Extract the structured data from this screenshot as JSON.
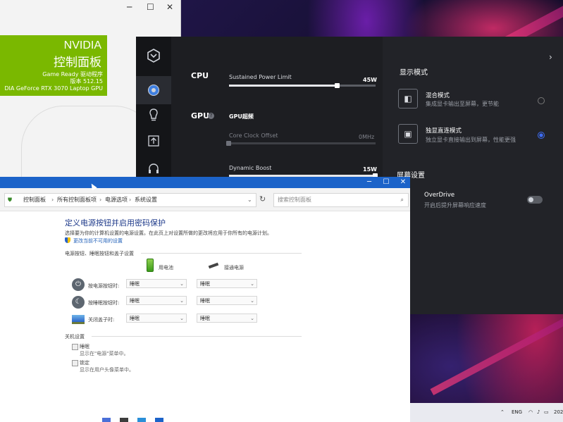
{
  "nvidia": {
    "brand": "NVIDIA",
    "title": "控制面板",
    "driver_line": "Game Ready 驱动程序",
    "version_line": "版本 512.15",
    "gpu_line": "DIA GeForce RTX 3070 Laptop GPU"
  },
  "gaming_center": {
    "cpu_label": "CPU",
    "cpu_spl_label": "Sustained Power Limit",
    "cpu_spl_value": "45W",
    "cpu_spl_level": 0.74,
    "gpu_label": "GPU",
    "gpu_oc_label": "GPU超频",
    "core_clock_label": "Core Clock Offset",
    "core_clock_value": "0MHz",
    "core_clock_level": 0.0,
    "dynamic_boost_label": "Dynamic Boost",
    "dynamic_boost_value": "15W",
    "dynamic_boost_level": 1.0,
    "display_mode_title": "显示模式",
    "mode_hybrid_title": "混合模式",
    "mode_hybrid_desc": "集成显卡输出至屏幕，更节能",
    "mode_discrete_title": "独显直连模式",
    "mode_discrete_desc": "独立显卡直接输出到屏幕，性能更强",
    "screen_settings_title": "屏幕设置",
    "overdrive_title": "OverDrive",
    "overdrive_desc": "开启后提升屏幕响应速度",
    "chevron": "›"
  },
  "control_panel": {
    "breadcrumb": [
      "控制面板",
      "所有控制面板项",
      "电源选项",
      "系统设置"
    ],
    "search_placeholder": "搜索控制面板",
    "heading": "定义电源按钮并启用密码保护",
    "description": "选择要为你的计算机设置的电源设置。在此页上对设置所做的更改将应用于你所有的电源计划。",
    "change_link": "更改当前不可用的设置",
    "section_buttons": "电源按钮、睡眠按钮和盖子设置",
    "col_battery": "用电池",
    "col_plugged": "接通电源",
    "rows": [
      {
        "label": "按电源按钮时:",
        "battery": "睡眠",
        "plugged": "睡眠"
      },
      {
        "label": "按睡眠按钮时:",
        "battery": "睡眠",
        "plugged": "睡眠"
      },
      {
        "label": "关闭盖子时:",
        "battery": "睡眠",
        "plugged": "睡眠"
      }
    ],
    "section_shutdown": "关机设置",
    "sleep_label": "睡眠",
    "sleep_desc": "显示在\"电源\"菜单中。",
    "lock_label": "锁定",
    "lock_desc": "显示在用户头像菜单中。"
  },
  "taskbar": {
    "lang": "ENG",
    "time_fragment": "202"
  }
}
